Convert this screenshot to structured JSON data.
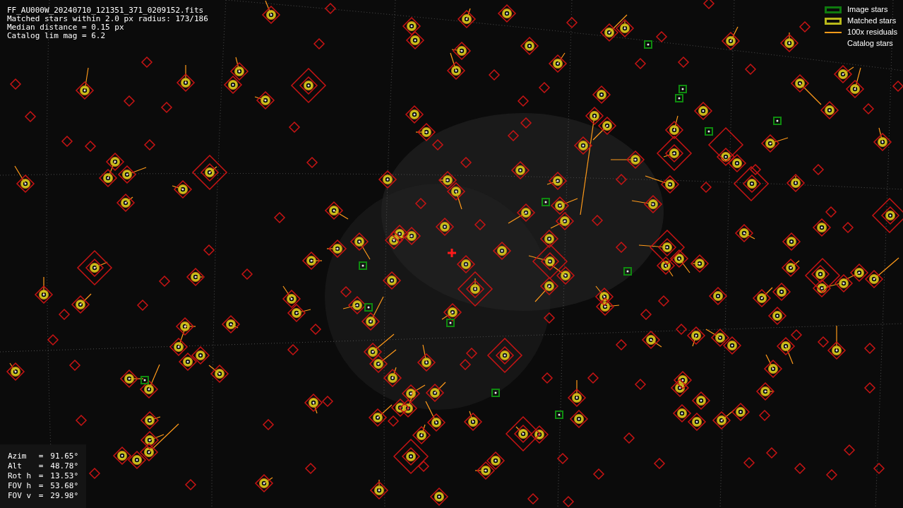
{
  "info_lines": [
    "FF_AU000W_20240710_121351_371_0209152.fits",
    "Matched stars within 2.0 px radius: 173/186",
    "Median distance = 0.15 px",
    "Catalog lim mag = 6.2"
  ],
  "legend": [
    {
      "kind": "box",
      "label": "Image stars",
      "color": "#0f7a0f"
    },
    {
      "kind": "box",
      "label": "Matched stars",
      "color": "#b8b81a"
    },
    {
      "kind": "line",
      "label": "100x residuals",
      "color": "#ff9a1a"
    },
    {
      "kind": "none",
      "label": "Catalog stars"
    }
  ],
  "pointing": [
    {
      "name": "Azim",
      "sign": "=",
      "value": "91.65°"
    },
    {
      "name": "Alt",
      "sign": "=",
      "value": "48.78°"
    },
    {
      "name": "Rot h",
      "sign": "=",
      "value": "13.53°"
    },
    {
      "name": "FOV h",
      "sign": "=",
      "value": "53.68°"
    },
    {
      "name": "FOV v",
      "sign": "=",
      "value": "29.98°"
    }
  ]
}
